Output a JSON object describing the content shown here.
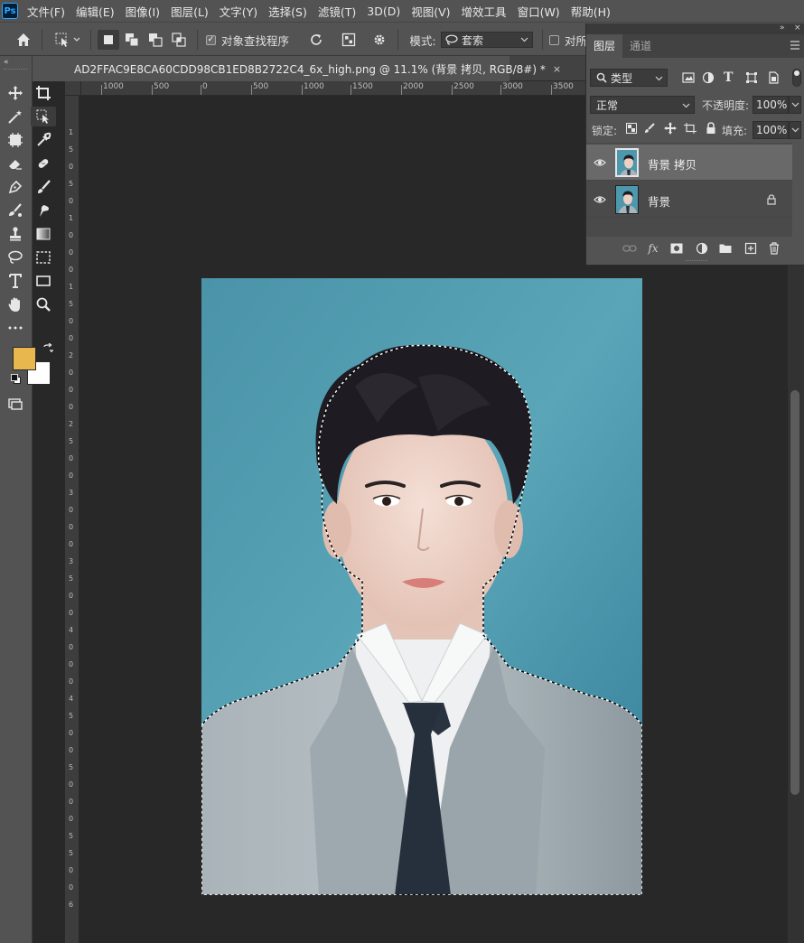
{
  "app": {
    "logo": "Ps"
  },
  "menu": [
    "文件(F)",
    "编辑(E)",
    "图像(I)",
    "图层(L)",
    "文字(Y)",
    "选择(S)",
    "滤镜(T)",
    "3D(D)",
    "视图(V)",
    "增效工具",
    "窗口(W)",
    "帮助(H)"
  ],
  "options": {
    "object_finder_label": "对象查找程序",
    "object_finder_checked": true,
    "mode_label": "模式:",
    "mode_value": "套索",
    "sample_all_label": "对所"
  },
  "document": {
    "tab_title": "AD2FFAC9E8CA60CDD98CB1ED8B2722C4_6x_high.png @ 11.1% (背景 拷贝, RGB/8#) *",
    "close_glyph": "×"
  },
  "ruler": {
    "horizontal": [
      "1000",
      "500",
      "0",
      "500",
      "1000",
      "1500",
      "2000",
      "2500",
      "3000",
      "3500"
    ],
    "vertical": [
      "1",
      "5",
      "0",
      "5",
      "0",
      "1",
      "0",
      "0",
      "0",
      "1",
      "5",
      "0",
      "0",
      "2",
      "0",
      "0",
      "0",
      "2",
      "5",
      "0",
      "0",
      "3",
      "0",
      "0",
      "0",
      "3",
      "5",
      "0",
      "0",
      "4",
      "0",
      "0",
      "0",
      "4",
      "5",
      "0",
      "0",
      "5",
      "0",
      "0",
      "0",
      "5",
      "5",
      "0",
      "0",
      "6"
    ]
  },
  "colors": {
    "foreground": "#e8b84f",
    "background": "#ffffff",
    "canvas_bg_top": "#4a93a8",
    "canvas_bg_bottom": "#3b8aa2",
    "suit": "#a7b2b8",
    "tie": "#2a3340",
    "hair": "#1e1c22",
    "skin": "#ecd0c4"
  },
  "layers_panel": {
    "tabs": [
      "图层",
      "通道"
    ],
    "filter_kind": "类型",
    "blend_mode": "正常",
    "opacity_label": "不透明度:",
    "opacity_value": "100%",
    "lock_label": "锁定:",
    "fill_label": "填充:",
    "fill_value": "100%",
    "layers": [
      {
        "name": "背景 拷贝",
        "selected": true,
        "locked": false
      },
      {
        "name": "背景",
        "selected": false,
        "locked": true
      }
    ]
  },
  "tools": [
    "move-tool",
    "crop-tool",
    "magic-wand-tool",
    "object-selection-tool",
    "frame-tool",
    "eyedropper-tool",
    "eraser-tool",
    "healing-brush-tool",
    "pen-tool",
    "brush-tool",
    "paint-bucket-tool",
    "smudge-tool",
    "stamp-tool",
    "gradient-tool",
    "lasso-tool",
    "marquee-tool",
    "type-tool",
    "rectangle-tool",
    "hand-tool",
    "zoom-tool",
    "more-tools",
    "quick-mask-tool"
  ]
}
